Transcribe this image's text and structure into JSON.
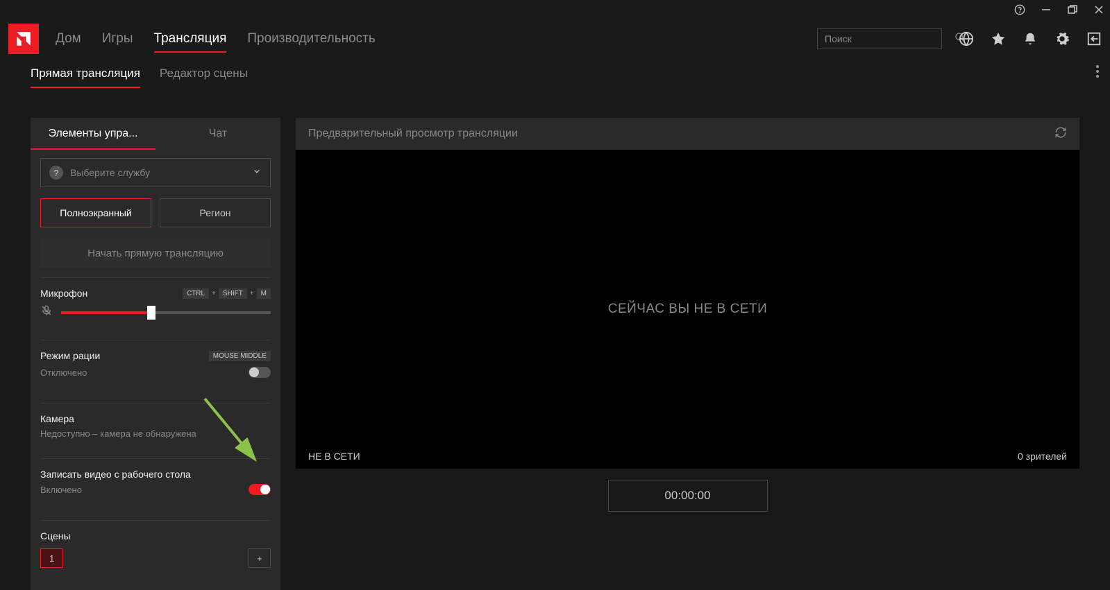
{
  "nav": {
    "tabs": [
      "Дом",
      "Игры",
      "Трансляция",
      "Производительность"
    ],
    "active_index": 2,
    "search_placeholder": "Поиск"
  },
  "subtabs": {
    "items": [
      "Прямая трансляция",
      "Редактор сцены"
    ],
    "active_index": 0
  },
  "left": {
    "tabs": [
      "Элементы упра...",
      "Чат"
    ],
    "active_index": 0,
    "service_placeholder": "Выберите службу",
    "capture_modes": [
      "Полноэкранный",
      "Регион"
    ],
    "capture_active": 0,
    "go_live": "Начать прямую трансляцию",
    "microphone": {
      "title": "Микрофон",
      "keys": [
        "CTRL",
        "SHIFT",
        "M"
      ],
      "value_pct": 43
    },
    "ptt": {
      "title": "Режим рации",
      "key": "MOUSE MIDDLE",
      "status": "Отключено",
      "enabled": false
    },
    "camera": {
      "title": "Камера",
      "status": "Недоступно – камера не обнаружена"
    },
    "desktop_record": {
      "title": "Записать видео с рабочего стола",
      "status": "Включено",
      "enabled": true
    },
    "scenes": {
      "title": "Сцены",
      "items": [
        "1"
      ],
      "active_index": 0
    }
  },
  "preview": {
    "title": "Предварительный просмотр трансляции",
    "offline_big": "СЕЙЧАС ВЫ НЕ В СЕТИ",
    "offline_small": "НЕ В СЕТИ",
    "viewers": "0 зрителей",
    "timer": "00:00:00"
  }
}
